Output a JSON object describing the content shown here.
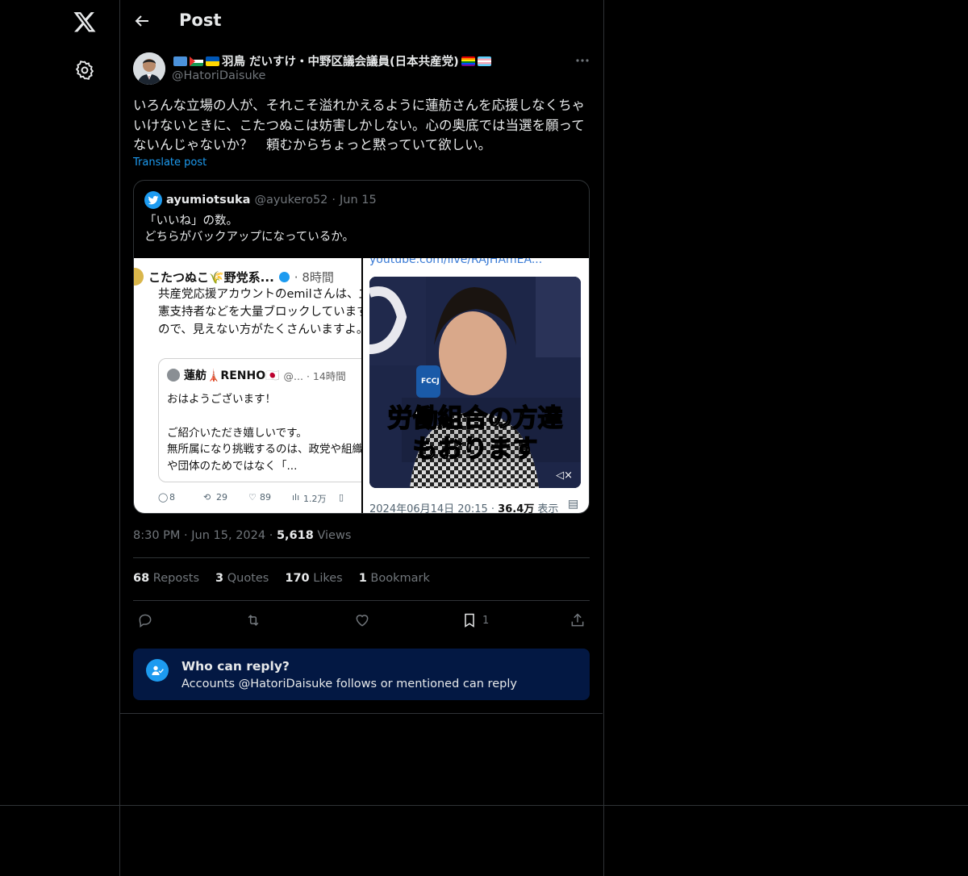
{
  "header": {
    "title": "Post"
  },
  "author": {
    "name": "羽鳥 だいすけ・中野区議会議員(日本共産党)",
    "handle": "@HatoriDaisuke"
  },
  "post": {
    "text": "いろんな立場の人が、それこそ溢れかえるように蓮舫さんを応援しなくちゃいけないときに、こたつぬこは妨害しかしない。心の奥底では当選を願ってないんじゃないか？　頼むからちょっと黙っていて欲しい。",
    "translate_label": "Translate post",
    "time": "8:30 PM",
    "date": "Jun 15, 2024",
    "views_count": "5,618",
    "views_label": "Views"
  },
  "quote": {
    "name": "ayumiotsuka",
    "handle": "@ayukero52",
    "date": "Jun 15",
    "text": "「いいね」の数。\nどちらがバックアップになっているか。",
    "left_image": {
      "author": "こたつぬこ🌾野党系...",
      "time": "· 8時間",
      "body": "共産党応援アカウントのemilさんは、立憲支持者などを大量ブロックしていますので、見えない方がたくさんいますよ。",
      "inner_author": "蓮舫🗼RENHO🇯🇵",
      "inner_meta": "@... · 14時間",
      "inner_text1": "おはようございます！",
      "inner_text2": "ご紹介いただき嬉しいです。",
      "inner_text3": "無所属になり挑戦するのは、政党や組織や団体のためではなく「...",
      "stat_reply": "8",
      "stat_repost": "29",
      "stat_like": "89",
      "stat_views": "1.2万"
    },
    "right_image": {
      "url_text": "youtube.com/live/RAJHAmEA...",
      "caption1": "労働組合の方達",
      "caption2": "もおります",
      "mic_label": "FCCJ",
      "footer_date": "2024年06月14日 20:15 ·",
      "footer_views": "36.4万",
      "footer_label": "表示"
    }
  },
  "stats": {
    "reposts_count": "68",
    "reposts_label": "Reposts",
    "quotes_count": "3",
    "quotes_label": "Quotes",
    "likes_count": "170",
    "likes_label": "Likes",
    "bookmarks_count": "1",
    "bookmarks_label": "Bookmark"
  },
  "actions": {
    "bookmark_count": "1"
  },
  "reply_restriction": {
    "title": "Who can reply?",
    "subtitle": "Accounts @HatoriDaisuke follows or mentioned can reply"
  },
  "colors": {
    "accent": "#1d9bf0",
    "muted": "#71767b",
    "text": "#e7e9ea",
    "reply_bg": "#031843"
  }
}
